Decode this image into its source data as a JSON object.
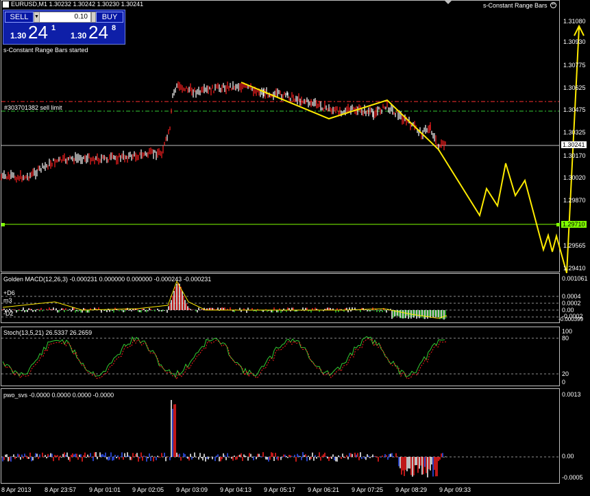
{
  "header": {
    "symbol_info": "EURUSD,M1  1.30232 1.30242 1.30230 1.30241",
    "indicator_name": "s-Constant Range Bars",
    "started_msg": "s-Constant Range Bars started"
  },
  "oneclick": {
    "sell_label": "SELL",
    "buy_label": "BUY",
    "lot": "0.10",
    "sell_prefix": "1.30",
    "sell_big": "24",
    "sell_sup": "1",
    "buy_prefix": "1.30",
    "buy_big": "24",
    "buy_sup": "8"
  },
  "order_label": "#303701382 sell limit",
  "price_axis": [
    "1.31080",
    "1.30930",
    "1.30775",
    "1.30625",
    "1.30475",
    "1.30325",
    "1.30170",
    "1.30020",
    "1.29870",
    "1.29565",
    "1.29410"
  ],
  "current_price_tag": "1.30241",
  "green_line_tag": "1.29710",
  "macd": {
    "title": "Golden MACD(12,26,3) -0.000231 0.000000 0.000000 -0.000243 -0.000231",
    "labels": [
      "+D6",
      "m3",
      "-D2"
    ],
    "axis": [
      "0.001061",
      "0.0004",
      "0.0002",
      "0.00",
      "-0.0002",
      "-0.000399"
    ]
  },
  "stoch": {
    "title": "Stoch(13,5,21) 26.5337 26.2659",
    "axis": [
      "100",
      "80",
      "20",
      "0"
    ]
  },
  "pwo": {
    "title": "pwo_svs -0.0000 0.0000 0.0000 -0.0000",
    "axis": [
      "0.0013",
      "0.00",
      "-0.0005"
    ]
  },
  "time_axis": [
    "8 Apr 2013",
    "8 Apr 23:57",
    "9 Apr 01:01",
    "9 Apr 02:05",
    "9 Apr 03:09",
    "9 Apr 04:13",
    "9 Apr 05:17",
    "9 Apr 06:21",
    "9 Apr 07:25",
    "9 Apr 08:29",
    "9 Apr 09:33"
  ],
  "colors": {
    "price_line": "#ffffff",
    "annotation": "#ffeb00",
    "green_level": "#7fff00",
    "order_level": "#ff3030",
    "grid_dash": "#c0c0c0"
  }
}
